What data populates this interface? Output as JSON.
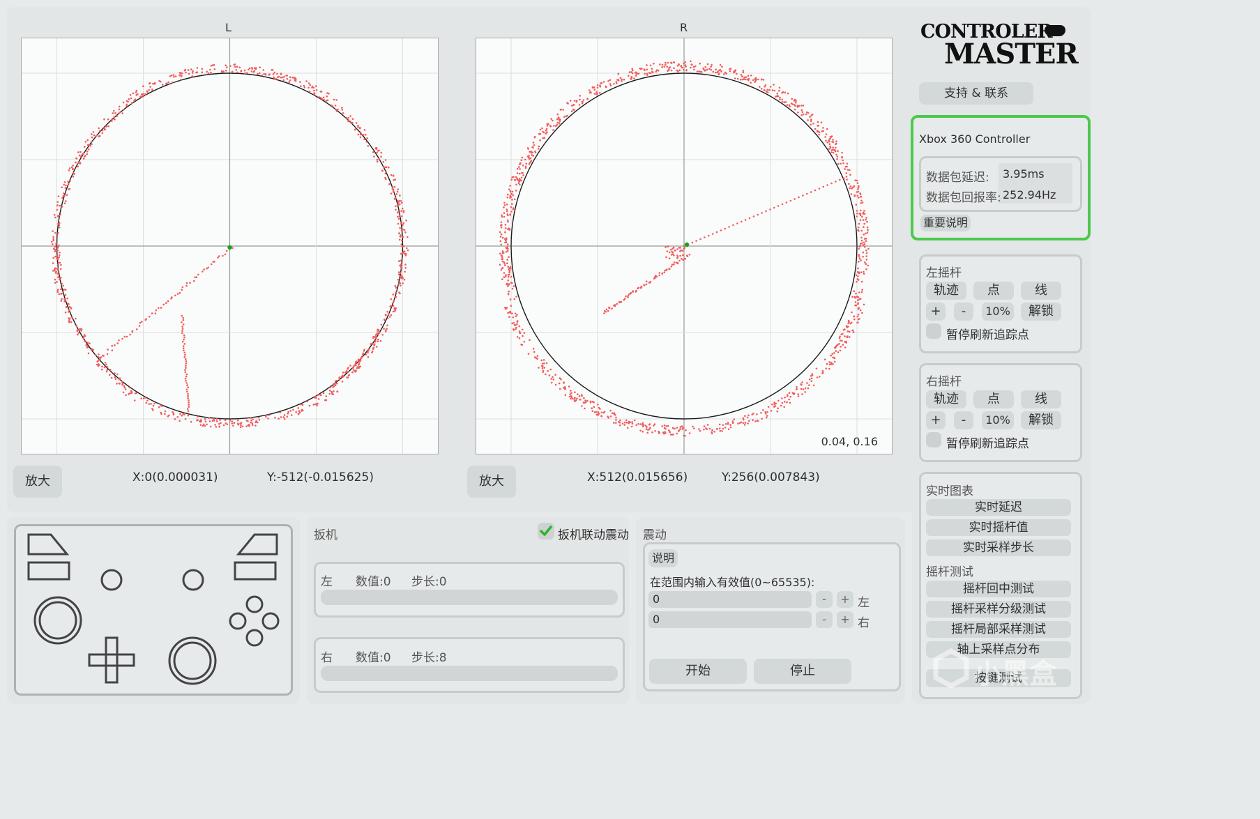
{
  "left_plot": {
    "title": "L",
    "zoom_label": "放大",
    "x_readout": "X:0(0.000031)",
    "y_readout": "Y:-512(-0.015625)"
  },
  "right_plot": {
    "title": "R",
    "zoom_label": "放大",
    "x_readout": "X:512(0.015656)",
    "y_readout": "Y:256(0.007843)",
    "corner_value": "0.04, 0.16"
  },
  "brand": {
    "line1": "CONTROLER",
    "line2": "MASTER",
    "support_label": "支持 & 联系"
  },
  "device": {
    "name": "Xbox 360 Controller",
    "latency_label": "数据包延迟:",
    "latency_value": "3.95ms",
    "rate_label": "数据包回报率:",
    "rate_value": "252.94Hz",
    "note_label": "重要说明",
    "highlight_color": "#4cc94c"
  },
  "left_stick": {
    "title": "左摇杆",
    "trace": "轨迹",
    "dot": "点",
    "line": "线",
    "plus": "+",
    "minus": "-",
    "percent": "10%",
    "unlock": "解锁",
    "pause": "暂停刷新追踪点"
  },
  "right_stick": {
    "title": "右摇杆",
    "trace": "轨迹",
    "dot": "点",
    "line": "线",
    "plus": "+",
    "minus": "-",
    "percent": "10%",
    "unlock": "解锁",
    "pause": "暂停刷新追踪点"
  },
  "realtime": {
    "title": "实时图表",
    "items": [
      "实时延迟",
      "实时摇杆值",
      "实时采样步长"
    ],
    "test_title": "摇杆测试",
    "tests": [
      "摇杆回中测试",
      "摇杆采样分级测试",
      "摇杆局部采样测试",
      "轴上采样点分布",
      "按键测试"
    ]
  },
  "trigger": {
    "title": "扳机",
    "link_label": "扳机联动震动",
    "link_checked": true,
    "left": {
      "side": "左",
      "value": "数值:0",
      "step": "步长:0",
      "level": 0
    },
    "right": {
      "side": "右",
      "value": "数值:0",
      "step": "步长:8",
      "level": 0
    }
  },
  "vibration": {
    "title": "震动",
    "note_label": "说明",
    "hint": "在范围内输入有效值(0~65535):",
    "left_value": "0",
    "right_value": "0",
    "minus": "-",
    "plus": "+",
    "left_side": "左",
    "right_side": "右",
    "start_label": "开始",
    "stop_label": "停止"
  },
  "watermark": {
    "text": "小黑盒"
  },
  "colors": {
    "trace": "#f25c5c",
    "center_point": "#1aa31a",
    "circle": "#1a1a1a"
  }
}
